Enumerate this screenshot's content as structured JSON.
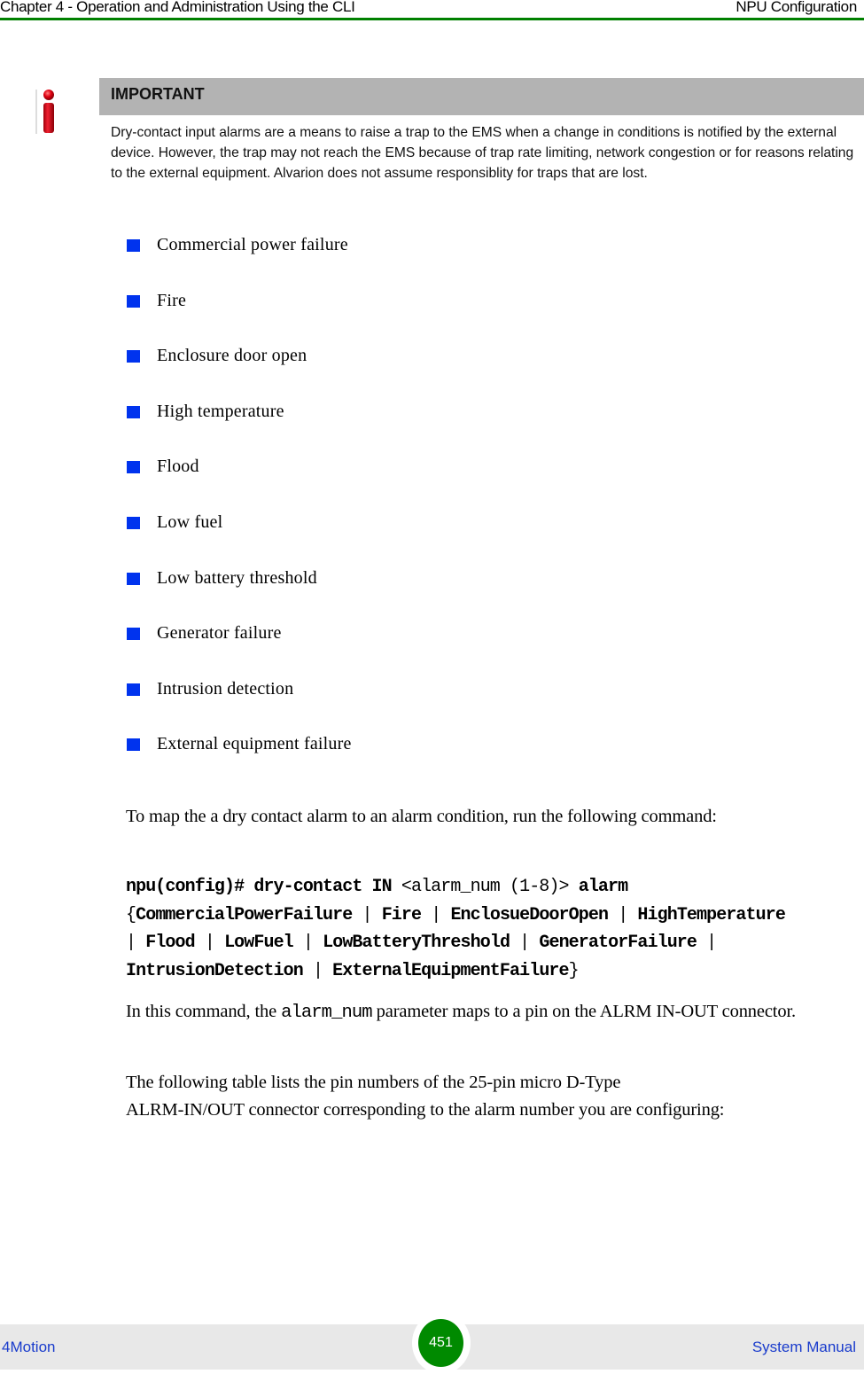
{
  "header": {
    "chapter": "Chapter 4 - Operation and Administration Using the CLI",
    "section": "NPU Configuration"
  },
  "note": {
    "icon": "info-icon",
    "title": "IMPORTANT",
    "body": "Dry-contact input alarms are a means to raise a trap to the EMS when a change in conditions is notified by the external device. However, the trap may not reach the EMS because of trap rate limiting, network congestion or for reasons relating to the external equipment. Alvarion does not assume responsiblity for traps that are lost."
  },
  "bullets": [
    "Commercial power failure",
    "Fire",
    "Enclosure door open",
    "High temperature",
    "Flood",
    "Low fuel",
    "Low battery threshold",
    "Generator failure",
    "Intrusion detection",
    "External equipment failure"
  ],
  "intro_paragraph": "To map the a dry contact alarm to an alarm condition, run the following command:",
  "command": {
    "prefix": "npu(config)# dry-contact IN",
    "param": "<alarm_num (1-8)>",
    "keyword": "alarm",
    "open_brace": "{",
    "close_brace": "}",
    "separator": "|",
    "options": [
      "CommercialPowerFailure",
      "Fire",
      "EnclosueDoorOpen",
      "HighTemperature",
      "Flood",
      "LowFuel",
      "LowBatteryThreshold",
      "GeneratorFailure",
      "IntrusionDetection",
      "ExternalEquipmentFailure"
    ]
  },
  "param_paragraph": {
    "before": "In this command, the ",
    "code": "alarm_num",
    "after": " parameter maps to a pin on the ALRM IN-OUT connector."
  },
  "table_intro_line1": "The following table lists the pin numbers of the 25-pin micro D-Type",
  "table_intro_line2": "ALRM-IN/OUT connector corresponding to the alarm number you are configuring:",
  "footer": {
    "product": "4Motion",
    "page_number": "451",
    "doc_title": "System Manual"
  },
  "colors": {
    "header_rule": "#008000",
    "bullet": "#0033ee",
    "note_header_bg": "#b3b3b3",
    "footer_bg": "#e8e8e8",
    "footer_text": "#1a3ccc",
    "page_badge": "#008a00"
  }
}
